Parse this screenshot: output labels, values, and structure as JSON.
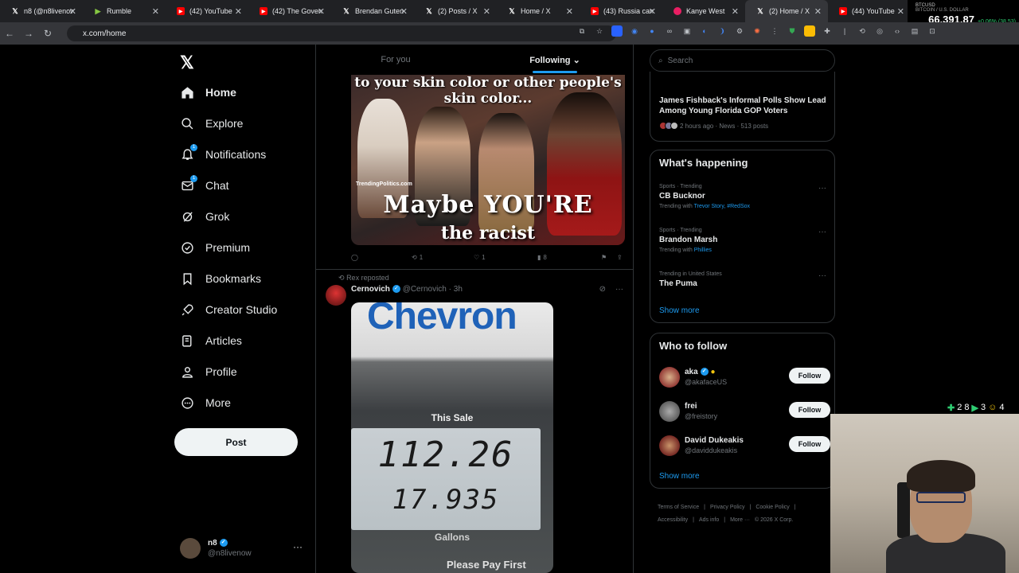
{
  "browser": {
    "tabs": [
      {
        "icon": "x",
        "label": "n8 (@n8livenow"
      },
      {
        "icon": "rumble",
        "label": "Rumble"
      },
      {
        "icon": "yt",
        "label": "(42) YouTube"
      },
      {
        "icon": "yt",
        "label": "(42) The Govern"
      },
      {
        "icon": "x",
        "label": "Brendan Guten"
      },
      {
        "icon": "x",
        "label": "(2) Posts / X"
      },
      {
        "icon": "x",
        "label": "Home / X"
      },
      {
        "icon": "yt",
        "label": "(43) Russia can"
      },
      {
        "icon": "kanye",
        "label": "Kanye West"
      },
      {
        "icon": "x",
        "label": "(2) Home / X",
        "active": true
      },
      {
        "icon": "yt",
        "label": "(44) YouTube"
      }
    ],
    "url": "x.com/home",
    "ticker": {
      "symbol": "BTCUSD",
      "pair": "BITCOIN / U.S. DOLLAR",
      "price": "66,391.87",
      "change": "+0.06% (38.53)"
    }
  },
  "nav": {
    "items": [
      {
        "key": "home",
        "label": "Home",
        "icon": "home-icon"
      },
      {
        "key": "explore",
        "label": "Explore",
        "icon": "search-icon"
      },
      {
        "key": "notifications",
        "label": "Notifications",
        "icon": "bell-icon",
        "badge": "1"
      },
      {
        "key": "chat",
        "label": "Chat",
        "icon": "mail-icon",
        "badge": "1"
      },
      {
        "key": "grok",
        "label": "Grok",
        "icon": "grok-icon"
      },
      {
        "key": "premium",
        "label": "Premium",
        "icon": "premium-icon"
      },
      {
        "key": "bookmarks",
        "label": "Bookmarks",
        "icon": "bookmark-icon"
      },
      {
        "key": "creator",
        "label": "Creator Studio",
        "icon": "rocket-icon"
      },
      {
        "key": "articles",
        "label": "Articles",
        "icon": "article-icon"
      },
      {
        "key": "profile",
        "label": "Profile",
        "icon": "person-icon"
      },
      {
        "key": "more",
        "label": "More",
        "icon": "more-circle-icon"
      }
    ],
    "post_label": "Post",
    "account": {
      "name": "n8",
      "handle": "@n8livenow"
    }
  },
  "feed": {
    "tabs": {
      "for_you": "For you",
      "following": "Following"
    },
    "tweet1": {
      "meme_top": "to your skin color or other people's skin color...",
      "meme_watermark": "TrendingPolitics.com",
      "meme_big": "Maybe YOU'RE",
      "meme_sub": "the racist",
      "retweets": "1",
      "likes": "1",
      "views": "8"
    },
    "tweet2": {
      "repost_text": "Rex reposted",
      "name": "Cernovich",
      "handle": "@Cernovich",
      "time": "3h",
      "img_brand": "Chevron",
      "img_this_sale": "This Sale",
      "img_amount": "112.26",
      "img_gallons": "17.935",
      "img_gallons_label": "Gallons",
      "img_pay": "Please Pay First"
    }
  },
  "right": {
    "search_placeholder": "Search",
    "news": {
      "title": "James Fishback's Informal Polls Show Lead Among Young Florida GOP Voters",
      "meta": "2 hours ago · News · 513 posts"
    },
    "happening": {
      "title": "What's happening",
      "trends": [
        {
          "meta": "Sports · Trending",
          "title": "CB Bucknor",
          "with_label": "Trending with",
          "links": "Trevor Story, #RedSox"
        },
        {
          "meta": "Sports · Trending",
          "title": "Brandon Marsh",
          "with_label": "Trending with",
          "links": "Phillies"
        },
        {
          "meta": "Trending in United States",
          "title": "The Puma",
          "with_label": "",
          "links": ""
        }
      ],
      "show_more": "Show more"
    },
    "who_to_follow": {
      "title": "Who to follow",
      "users": [
        {
          "name": "aka",
          "handle": "@akafaceUS",
          "button": "Follow"
        },
        {
          "name": "frei",
          "handle": "@freistory",
          "button": "Follow"
        },
        {
          "name": "David Dukeakis",
          "handle": "@daviddukeakis",
          "button": "Follow"
        }
      ],
      "show_more": "Show more"
    },
    "footer": {
      "links": [
        "Terms of Service",
        "|",
        "Privacy Policy",
        "|",
        "Cookie Policy",
        "|",
        "Accessibility",
        "|",
        "Ads info",
        "|",
        "More ···",
        "© 2026 X Corp."
      ]
    }
  },
  "overlay": {
    "stat1": "2 8",
    "stat2": "3",
    "stat3": "4"
  },
  "colors": {
    "accent": "#1d9bf0",
    "background": "#000000",
    "border": "#2f3336",
    "muted": "#71767b"
  }
}
